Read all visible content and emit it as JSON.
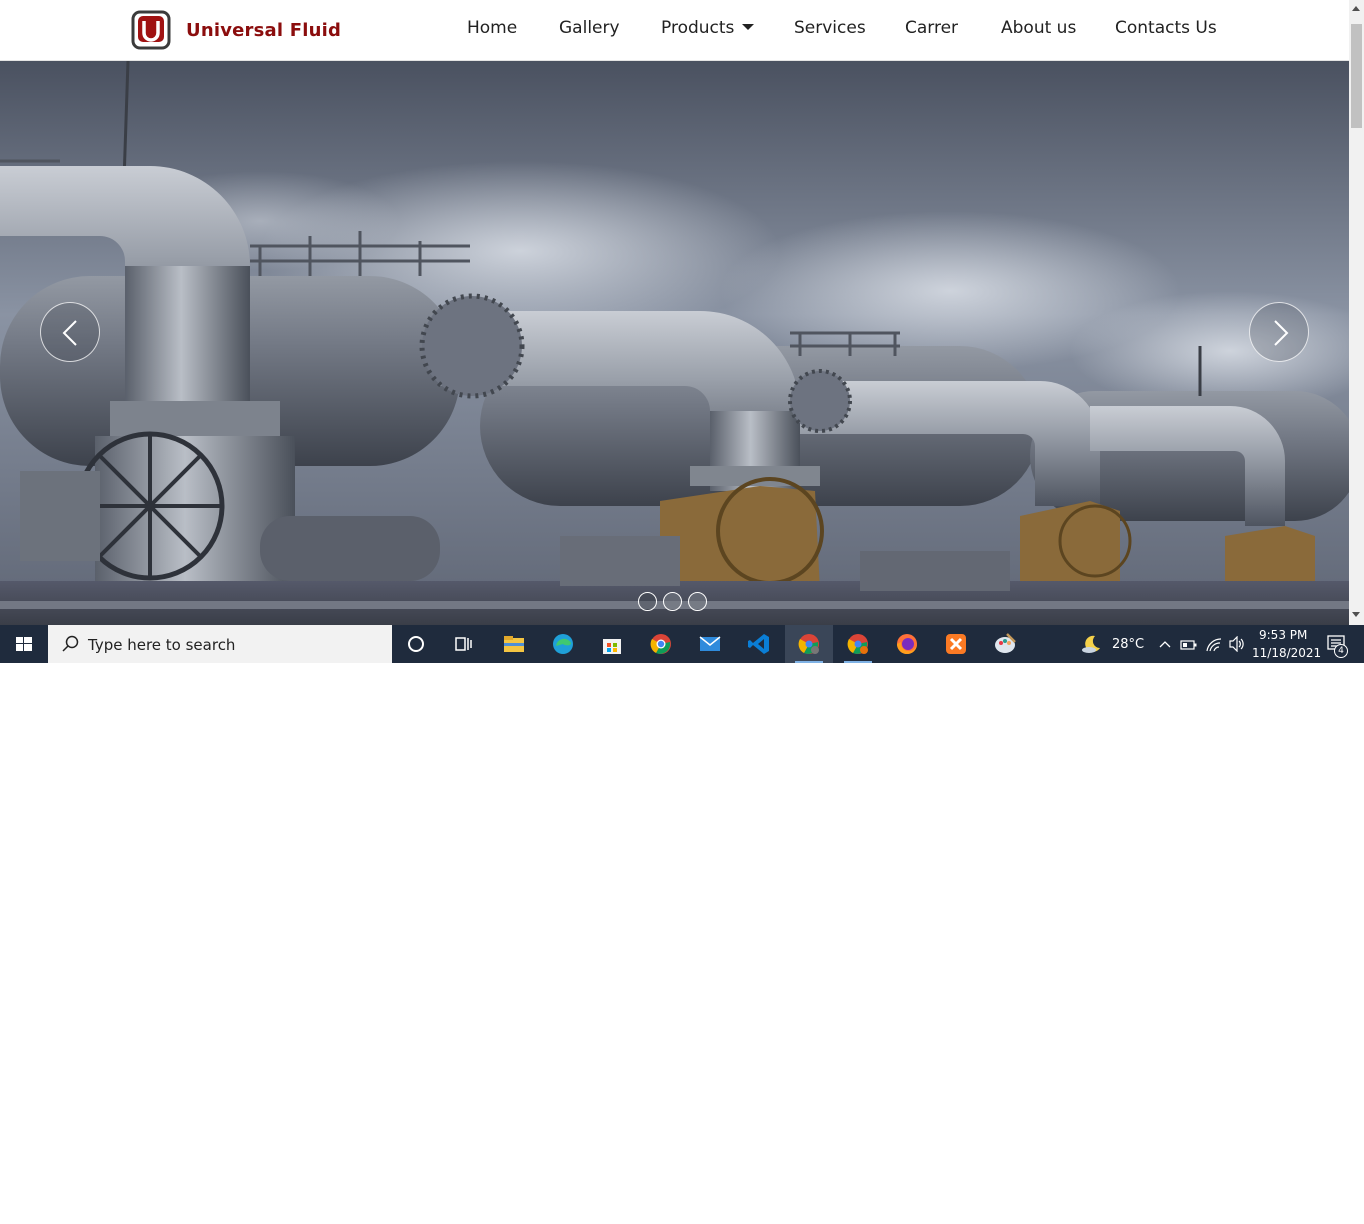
{
  "brand": {
    "name": "Universal Fluid",
    "logo_letter": "U",
    "color": "#8b0d0d"
  },
  "nav": {
    "items": [
      {
        "label": "Home"
      },
      {
        "label": "Gallery"
      },
      {
        "label": "Products",
        "has_dropdown": true
      },
      {
        "label": "Services"
      },
      {
        "label": "Carrer"
      },
      {
        "label": "About us"
      },
      {
        "label": "Contacts Us"
      }
    ]
  },
  "hero": {
    "image": "industrial-pipeline-valves-photo",
    "prev_icon": "chevron-left-icon",
    "next_icon": "chevron-right-icon",
    "slide_count": 3,
    "active_slide": 1
  },
  "taskbar": {
    "search_placeholder": "Type here to search",
    "pinned": [
      "cortana-icon",
      "task-view-icon",
      "file-explorer-icon",
      "edge-icon",
      "store-icon",
      "chrome-icon",
      "mail-icon",
      "vscode-icon",
      "chrome-profile-icon",
      "chrome-dev-icon",
      "firefox-icon",
      "xampp-icon",
      "paint-icon"
    ],
    "weather": "28°C",
    "time": "9:53 PM",
    "date": "11/18/2021",
    "notification_count": "4"
  },
  "colors": {
    "taskbar": "#1f2b3d",
    "nav_text": "#222222",
    "brand": "#8b0d0d"
  }
}
